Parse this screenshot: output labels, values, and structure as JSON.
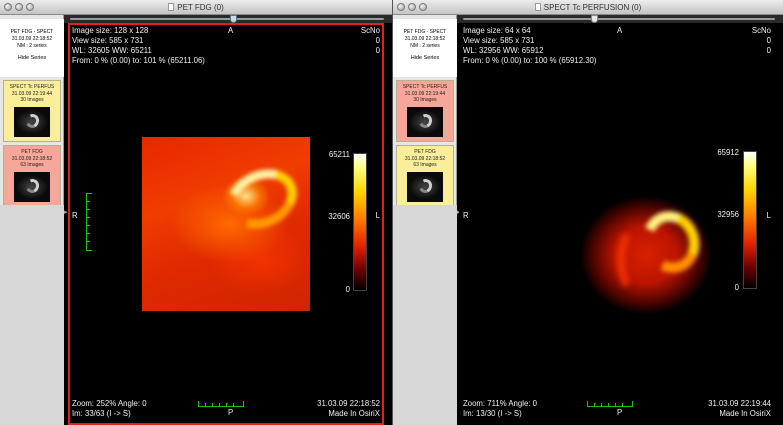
{
  "colors": {
    "active_border": "#e0201a",
    "ruler": "#1bc01b",
    "panel_bg": "#e6e6e6"
  },
  "left_window": {
    "title": "PET FDG (0)",
    "study": {
      "name": "PET FDG - SPECT",
      "date": "31.03.09 22:18:52",
      "info": "NM : 2 series",
      "hide_label": "Hide Series"
    },
    "series": [
      {
        "name": "SPECT Tc PERFUS",
        "date": "31.03.09 22:19:44",
        "count": "30 Images",
        "color": "#fbee9a"
      },
      {
        "name": "PET FDG",
        "date": "31.03.09 22:18:52",
        "count": "63 Images",
        "color": "#f6a79a"
      }
    ],
    "overlay": {
      "line1": "Image size: 128 x 128",
      "line2": "View size: 585 x 731",
      "line3": "WL: 32605 WW: 65211",
      "line4": "From: 0 % (0.00) to: 101 % (65211.06)",
      "top": "A",
      "scno_label": "ScNo",
      "scno_1": "0",
      "scno_2": "0",
      "left": "R",
      "right": "L",
      "bottom": "P",
      "zoom": "Zoom: 252% Angle: 0",
      "im": "Im: 33/63  (I -> S)",
      "datetime": "31.03.09 22:18:52",
      "made": "Made In OsiriX"
    },
    "colorbar": {
      "max": "65211",
      "mid": "32606",
      "min": "0"
    },
    "slider_position": 0.52
  },
  "right_window": {
    "title": "SPECT Tc PERFUSION (0)",
    "study": {
      "name": "PET FDG - SPECT",
      "date": "31.03.09 22:18:52",
      "info": "NM : 2 series",
      "hide_label": "Hide Series"
    },
    "series": [
      {
        "name": "SPECT Tc PERFUS",
        "date": "31.03.09 22:19:44",
        "count": "30 Images",
        "color": "#f6a79a"
      },
      {
        "name": "PET FDG",
        "date": "31.03.09 22:18:52",
        "count": "63 Images",
        "color": "#fbee9a"
      }
    ],
    "overlay": {
      "line1": "Image size: 64 x 64",
      "line2": "View size: 585 x 731",
      "line3": "WL: 32956 WW: 65912",
      "line4": "From: 0 % (0.00) to: 100 % (65912.30)",
      "top": "A",
      "scno_label": "ScNo",
      "scno_1": "0",
      "scno_2": "0",
      "left": "R",
      "right": "L",
      "bottom": "P",
      "zoom": "Zoom: 711% Angle: 0",
      "im": "Im: 13/30  (I -> S)",
      "datetime": "31.03.09 22:19:44",
      "made": "Made In OsiriX"
    },
    "colorbar": {
      "max": "65912",
      "mid": "32956",
      "min": "0"
    },
    "slider_position": 0.42
  }
}
